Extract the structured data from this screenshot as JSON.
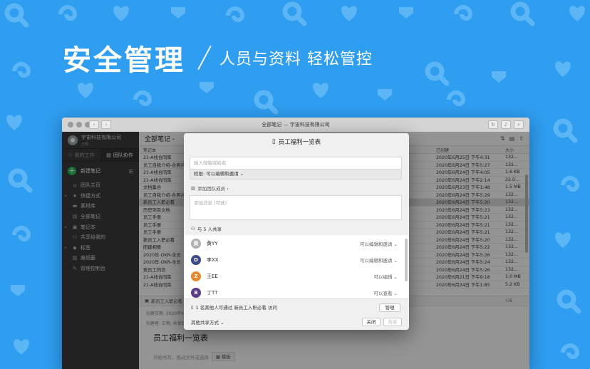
{
  "hero": {
    "title": "安全管理",
    "subtitle": "人员与资料 轻松管控"
  },
  "window": {
    "title": "全部笔记 — 宇宙科技有限公司"
  },
  "sidebar": {
    "org_name": "宇宙科技有限公司",
    "org_sub": "王畅",
    "tabs": [
      {
        "label": "我的工作"
      },
      {
        "label": "团队协作"
      }
    ],
    "new_note": "新建笔记",
    "items": [
      {
        "label": "团队主页",
        "icon": "house-icon",
        "arrow": ""
      },
      {
        "label": "快捷方式",
        "icon": "star-icon",
        "arrow": "▸"
      },
      {
        "label": "素材库",
        "icon": "folder-icon",
        "arrow": ""
      },
      {
        "label": "全部笔记",
        "icon": "note-icon",
        "arrow": ""
      },
      {
        "label": "笔记本",
        "icon": "notebook-icon",
        "arrow": "▸"
      },
      {
        "label": "共享给我的",
        "icon": "people-icon",
        "arrow": ""
      },
      {
        "label": "标签",
        "icon": "tag-icon",
        "arrow": "▸"
      },
      {
        "label": "废纸篓",
        "icon": "trash-icon",
        "arrow": ""
      },
      {
        "label": "管理控制台",
        "icon": "wrench-icon",
        "arrow": ""
      }
    ]
  },
  "notes": {
    "header": "全部笔记",
    "columns": {
      "name": "笔记本",
      "created": "已创建",
      "size": "大小"
    },
    "rows": [
      {
        "name": "21-A线合同库",
        "date": "2020年6月25日 下午4:31",
        "size": "132..."
      },
      {
        "name": "员工自我介绍-合照片",
        "date": "2020年6月24日 下午5:27",
        "size": "132..."
      },
      {
        "name": "21-A线合同库",
        "date": "2020年6月24日 下午4:05",
        "size": "1.6 KB"
      },
      {
        "name": "21-A线合同库",
        "date": "2020年6月24日 下午2:14",
        "size": "22.0..."
      },
      {
        "name": "文档集合",
        "date": "2020年6月23日 下午1:48",
        "size": "1.5 MB"
      },
      {
        "name": "员工自我介绍-合照片",
        "date": "2020年6月24日 下午5:29",
        "size": "132..."
      },
      {
        "name": "新员工入职必看",
        "date": "2020年6月24日 下午5:20",
        "size": "132..."
      },
      {
        "name": "历史项目文档",
        "date": "2020年6月24日 下午5:23",
        "size": "132..."
      },
      {
        "name": "员工手册",
        "date": "2020年6月24日 下午5:21",
        "size": "132..."
      },
      {
        "name": "员工手册",
        "date": "2020年6月24日 下午5:21",
        "size": "132..."
      },
      {
        "name": "员工手册",
        "date": "2020年6月24日 下午5:21",
        "size": "132..."
      },
      {
        "name": "新员工入职必看",
        "date": "2020年6月24日 下午5:20",
        "size": "132..."
      },
      {
        "name": "团建相册",
        "date": "2020年6月24日 下午5:22",
        "size": "132..."
      },
      {
        "name": "2020年-OKR-全员",
        "date": "2020年6月24日 下午5:26",
        "size": "132..."
      },
      {
        "name": "2020年-OKR-全员",
        "date": "2020年6月24日 下午5:24",
        "size": "132..."
      },
      {
        "name": "致员工的信",
        "date": "2020年6月24日 下午5:26",
        "size": "132..."
      },
      {
        "name": "21-A线合同库",
        "date": "2020年6月21日 下午9:18",
        "size": "1.0 MB"
      },
      {
        "name": "21-A线合同库",
        "date": "2020年6月24日 下午1:85",
        "size": "5.2 KB"
      }
    ]
  },
  "detail": {
    "notebook": "新员工入职必看",
    "share_count": "5",
    "created": "创建日期: 2020年6月24...",
    "author_line": "创建者: 王畅, 共享给",
    "title": "员工福利一览表",
    "hint": "开始书写，拖动文件或选择",
    "template_btn": "模板"
  },
  "modal": {
    "title": "员工福利一览表",
    "email_placeholder": "输入邮箱或姓名",
    "perm_label": "权限: 可以编辑和邀请 ⌄",
    "add_team": "添加团队成员 ›",
    "message_placeholder": "添加消息 (可选)",
    "shared_with": "与 5 人共享",
    "members": [
      {
        "name": "黄YY",
        "perm": "可以编辑和邀请 ⌄",
        "color": "#b0b0b0",
        "initial": "黄"
      },
      {
        "name": "李XX",
        "perm": "可以编辑和邀请 ⌄",
        "color": "#3a4a8a",
        "initial": "D"
      },
      {
        "name": "王EE",
        "perm": "可以编辑 ⌄",
        "color": "#e88a2a",
        "initial": "Z"
      },
      {
        "name": "丁TT",
        "perm": "可以查看 ⌄",
        "color": "#5a3a8a",
        "initial": "B"
      }
    ],
    "access_note": "1 名其他人可通过 新员工入职必看 访问",
    "manage_btn": "管理",
    "other_share": "其他共享方式 ⌄",
    "close_btn": "关闭",
    "share_btn": "共享"
  }
}
